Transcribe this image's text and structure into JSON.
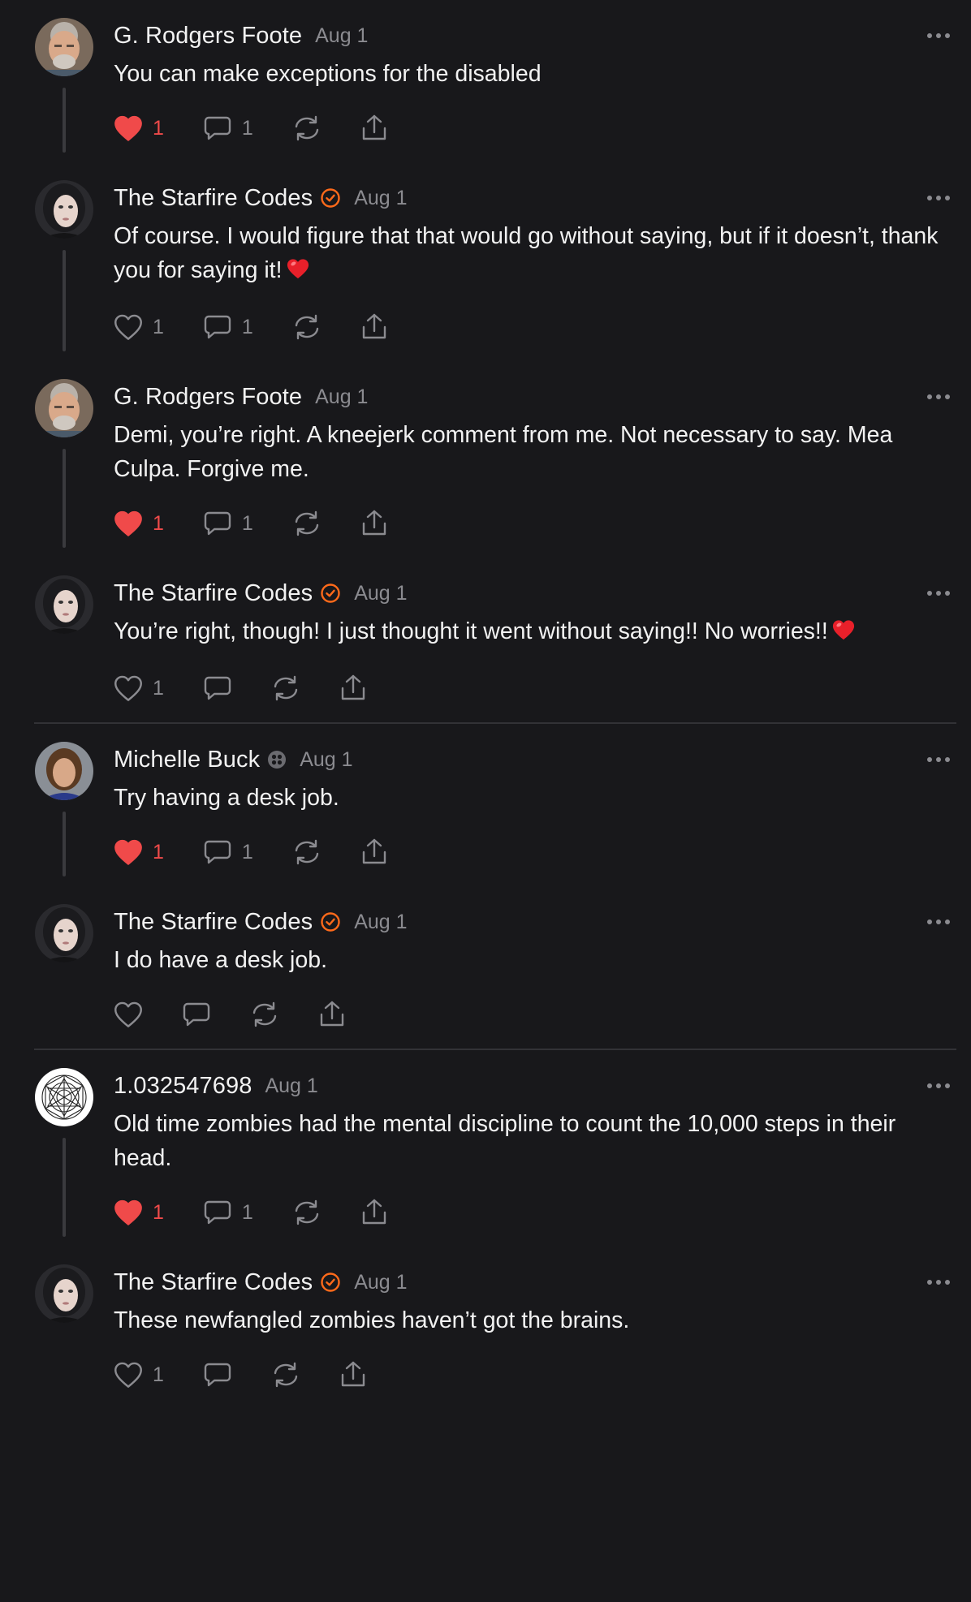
{
  "colors": {
    "background": "#18181b",
    "text": "#f2f2f2",
    "muted": "#8b8b90",
    "liked_red": "#f04a4a",
    "verified_orange": "#ff6a1a",
    "thread_line": "#3a3a3e"
  },
  "comments": [
    {
      "author": "G. Rodgers Foote",
      "badge": "",
      "date": "Aug 1",
      "text": "You can make exceptions for the disabled",
      "emoji": "",
      "likes": "1",
      "liked": true,
      "replies": "1",
      "avatar": "man-gray-hair",
      "thread": true,
      "divider_after": false
    },
    {
      "author": "The Starfire Codes",
      "badge": "verified-icon",
      "date": "Aug 1",
      "text": "Of course. I would figure that that would go without saying, but if it doesn’t, thank you for saying it!",
      "emoji": "red-heart",
      "likes": "1",
      "liked": false,
      "replies": "1",
      "avatar": "woman-dark-hair",
      "thread": true,
      "divider_after": false
    },
    {
      "author": "G. Rodgers Foote",
      "badge": "",
      "date": "Aug 1",
      "text": "Demi, you’re right. A kneejerk comment from me. Not necessary to say. Mea Culpa. Forgive me.",
      "emoji": "",
      "likes": "1",
      "liked": true,
      "replies": "1",
      "avatar": "man-gray-hair",
      "thread": true,
      "divider_after": false
    },
    {
      "author": "The Starfire Codes",
      "badge": "verified-icon",
      "date": "Aug 1",
      "text": "You’re right, though! I just thought it went without saying!! No worries!!",
      "emoji": "red-heart",
      "likes": "1",
      "liked": false,
      "replies": "",
      "avatar": "woman-dark-hair",
      "thread": false,
      "divider_after": true
    },
    {
      "author": "Michelle Buck",
      "badge": "subscriber-icon",
      "date": "Aug 1",
      "text": "Try having a desk job.",
      "emoji": "",
      "likes": "1",
      "liked": true,
      "replies": "1",
      "avatar": "woman-brown-hair",
      "thread": true,
      "divider_after": false
    },
    {
      "author": "The Starfire Codes",
      "badge": "verified-icon",
      "date": "Aug 1",
      "text": "I do have a desk job.",
      "emoji": "",
      "likes": "",
      "liked": false,
      "replies": "",
      "avatar": "woman-dark-hair",
      "thread": false,
      "divider_after": true
    },
    {
      "author": "1.032547698",
      "badge": "",
      "date": "Aug 1",
      "text": "Old time zombies had the mental discipline to count the 10,000 steps in their head.",
      "emoji": "",
      "likes": "1",
      "liked": true,
      "replies": "1",
      "avatar": "geometric-mandala",
      "thread": true,
      "divider_after": false
    },
    {
      "author": "The Starfire Codes",
      "badge": "verified-icon",
      "date": "Aug 1",
      "text": "These newfangled zombies haven’t got the brains.",
      "emoji": "",
      "likes": "1",
      "liked": false,
      "replies": "",
      "avatar": "woman-dark-hair",
      "thread": false,
      "divider_after": false
    }
  ]
}
